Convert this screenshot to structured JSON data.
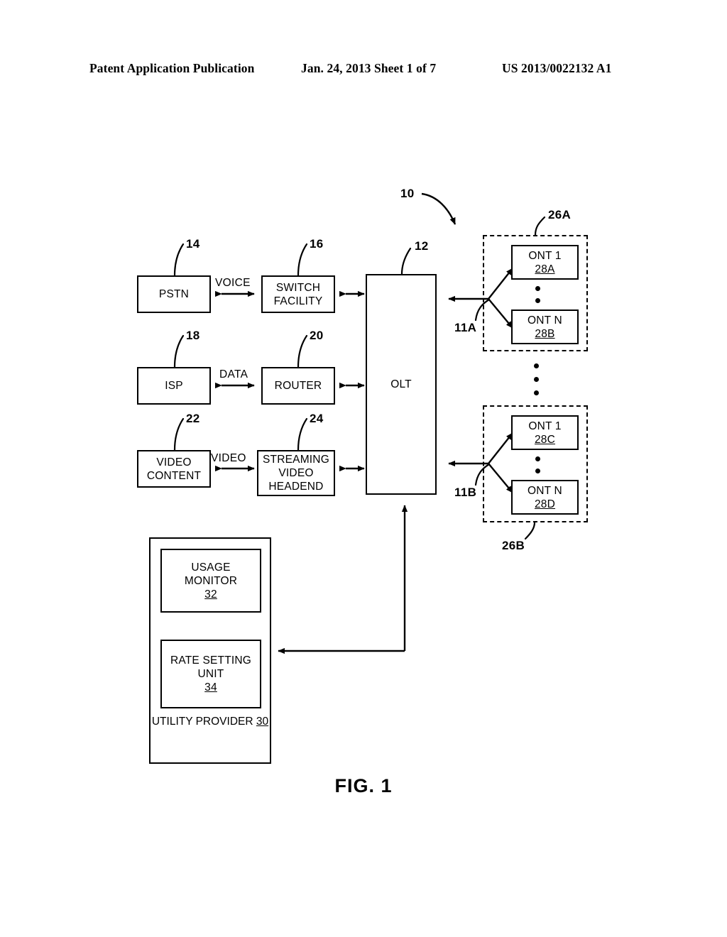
{
  "header": {
    "left": "Patent Application Publication",
    "middle": "Jan. 24, 2013  Sheet 1 of 7",
    "right": "US 2013/0022132 A1"
  },
  "figure": {
    "caption": "FIG. 1",
    "system_ref": "10"
  },
  "nodes": {
    "pstn": {
      "label": "PSTN",
      "ref": "14"
    },
    "switch": {
      "line1": "SWITCH",
      "line2": "FACILITY",
      "ref": "16"
    },
    "isp": {
      "label": "ISP",
      "ref": "18"
    },
    "router": {
      "label": "ROUTER",
      "ref": "20"
    },
    "video": {
      "line1": "VIDEO",
      "line2": "CONTENT",
      "ref": "22"
    },
    "headend": {
      "line1": "STREAMING",
      "line2": "VIDEO",
      "line3": "HEADEND",
      "ref": "24"
    },
    "olt": {
      "label": "OLT",
      "ref": "12"
    },
    "ont_1a": {
      "label": "ONT 1",
      "ref": "28A"
    },
    "ont_na": {
      "label": "ONT N",
      "ref": "28B"
    },
    "ont_1b": {
      "label": "ONT 1",
      "ref": "28C"
    },
    "ont_nb": {
      "label": "ONT N",
      "ref": "28D"
    },
    "usage_monitor": {
      "line1": "USAGE",
      "line2": "MONITOR",
      "ref": "32"
    },
    "rate_setting": {
      "line1": "RATE SETTING",
      "line2": "UNIT",
      "ref": "34"
    },
    "utility": {
      "line1": "UTILITY",
      "line2": "PROVIDER",
      "ref": "30"
    }
  },
  "groups": {
    "ont_group_a": {
      "ref": "26A"
    },
    "ont_group_b": {
      "ref": "26B"
    }
  },
  "links": {
    "voice": "VOICE",
    "data": "DATA",
    "video": "VIDEO",
    "feeder_a": "11A",
    "feeder_b": "11B"
  }
}
